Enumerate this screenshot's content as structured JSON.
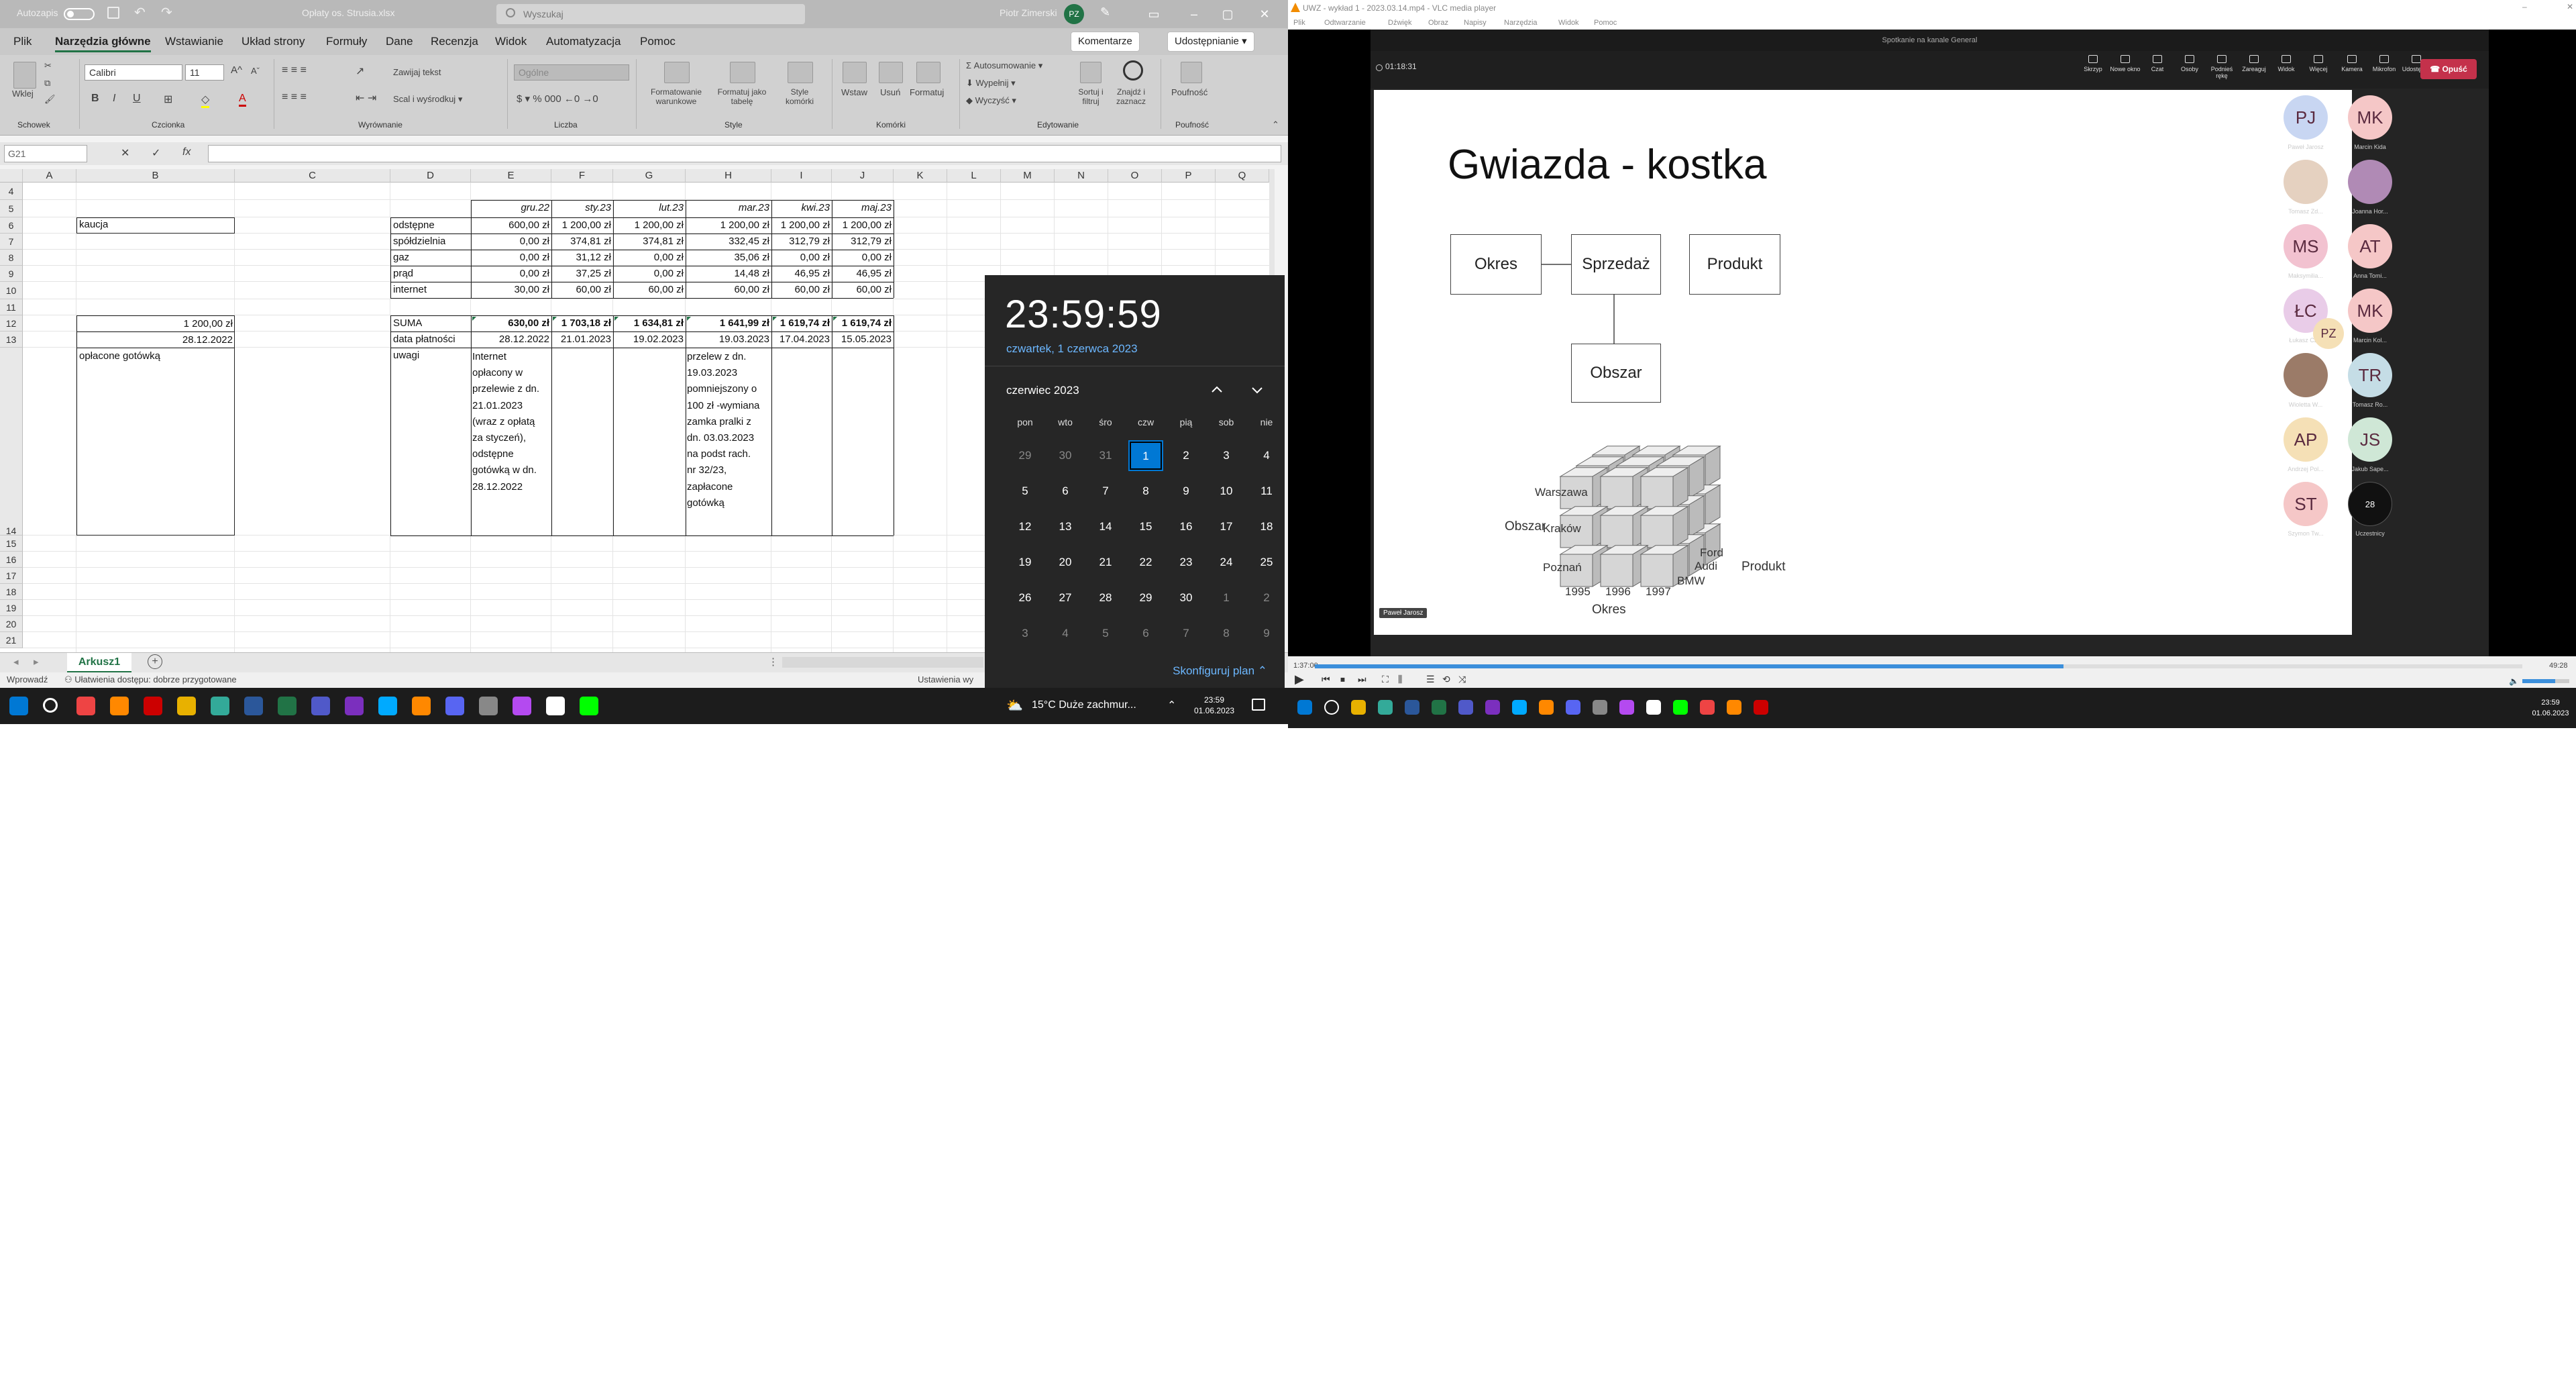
{
  "excel": {
    "autosave_label": "Autozapis",
    "file_name": "Opłaty os. Strusia.xlsx",
    "search_placeholder": "Wyszukaj",
    "user_name": "Piotr Zimerski",
    "user_initials": "PZ",
    "menu": [
      "Plik",
      "Narzędzia główne",
      "Wstawianie",
      "Układ strony",
      "Formuły",
      "Dane",
      "Recenzja",
      "Widok",
      "Automatyzacja",
      "Pomoc"
    ],
    "active_menu": "Narzędzia główne",
    "comments_label": "Komentarze",
    "share_label": "Udostępnianie",
    "ribbon": {
      "paste": "Wklej",
      "font_name": "Calibri",
      "font_size": "11",
      "wrap_text": "Zawijaj tekst",
      "merge": "Scal i wyśrodkuj",
      "number_format": "Ogólne",
      "cond_format": "Formatowanie warunkowe",
      "format_table": "Formatuj jako tabelę",
      "cell_styles": "Style komórki",
      "insert": "Wstaw",
      "delete": "Usuń",
      "format": "Formatuj",
      "autosum": "Autosumowanie",
      "fill": "Wypełnij",
      "clear": "Wyczyść",
      "sort": "Sortuj i filtruj",
      "find": "Znajdź i zaznacz",
      "sensitivity": "Poufność",
      "groups": [
        "Schowek",
        "Czcionka",
        "Wyrównanie",
        "Liczba",
        "Style",
        "Komórki",
        "Edytowanie",
        "Poufność"
      ]
    },
    "name_box": "G21",
    "fx": "fx",
    "columns": [
      "A",
      "B",
      "C",
      "D",
      "E",
      "F",
      "G",
      "H",
      "I",
      "J",
      "K",
      "L",
      "M",
      "N",
      "O",
      "P",
      "Q"
    ],
    "rows": [
      "4",
      "5",
      "6",
      "7",
      "8",
      "9",
      "10",
      "11",
      "12",
      "13",
      "14",
      "15",
      "16",
      "17",
      "18",
      "19",
      "20",
      "21"
    ],
    "cells": {
      "b6": "kaucja",
      "b12": "1 200,00 zł",
      "b13": "28.12.2022",
      "b14": "opłacone gotówką",
      "headers": [
        "gru.22",
        "sty.23",
        "lut.23",
        "mar.23",
        "kwi.23",
        "maj.23"
      ],
      "labels": [
        "odstępne",
        "spółdzielnia",
        "gaz",
        "prąd",
        "internet"
      ],
      "values": [
        [
          "600,00 zł",
          "1 200,00 zł",
          "1 200,00 zł",
          "1 200,00 zł",
          "1 200,00 zł",
          "1 200,00 zł"
        ],
        [
          "0,00 zł",
          "374,81 zł",
          "374,81 zł",
          "332,45 zł",
          "312,79 zł",
          "312,79 zł"
        ],
        [
          "0,00 zł",
          "31,12 zł",
          "0,00 zł",
          "35,06 zł",
          "0,00 zł",
          "0,00 zł"
        ],
        [
          "0,00 zł",
          "37,25 zł",
          "0,00 zł",
          "14,48 zł",
          "46,95 zł",
          "46,95 zł"
        ],
        [
          "30,00 zł",
          "60,00 zł",
          "60,00 zł",
          "60,00 zł",
          "60,00 zł",
          "60,00 zł"
        ]
      ],
      "suma_label": "SUMA",
      "suma": [
        "630,00 zł",
        "1 703,18 zł",
        "1 634,81 zł",
        "1 641,99 zł",
        "1 619,74 zł",
        "1 619,74 zł"
      ],
      "date_label": "data płatności",
      "dates": [
        "28.12.2022",
        "21.01.2023",
        "19.02.2023",
        "19.03.2023",
        "17.04.2023",
        "15.05.2023"
      ],
      "notes_label": "uwagi",
      "note_e": "Internet\nopłacony w\nprzelewie z dn.\n21.01.2023\n(wraz z opłatą\nza styczeń),\nodstępne\ngotówką w dn.\n28.12.2022",
      "note_h": "przelew z dn.\n19.03.2023\npomniejszony o\n100 zł -wymiana\nzamka pralki z\ndn. 03.03.2023\nna podst rach.\nnr 32/23,\nzapłacone\ngotówką"
    },
    "sheet_tab": "Arkusz1",
    "status_ready": "Wprowadź",
    "accessibility": "Ułatwienia dostępu: dobrze przygotowane",
    "display_settings": "Ustawienia wy"
  },
  "calendar": {
    "time": "23:59:59",
    "date_long": "czwartek, 1 czerwca 2023",
    "month": "czerwiec 2023",
    "weekdays": [
      "pon",
      "wto",
      "śro",
      "czw",
      "pią",
      "sob",
      "nie"
    ],
    "days": [
      [
        "29",
        "30",
        "31",
        "1",
        "2",
        "3",
        "4"
      ],
      [
        "5",
        "6",
        "7",
        "8",
        "9",
        "10",
        "11"
      ],
      [
        "12",
        "13",
        "14",
        "15",
        "16",
        "17",
        "18"
      ],
      [
        "19",
        "20",
        "21",
        "22",
        "23",
        "24",
        "25"
      ],
      [
        "26",
        "27",
        "28",
        "29",
        "30",
        "1",
        "2"
      ],
      [
        "3",
        "4",
        "5",
        "6",
        "7",
        "8",
        "9"
      ]
    ],
    "configure": "Skonfiguruj plan"
  },
  "taskbar_left": {
    "weather": "15°C  Duże zachmur...",
    "time": "23:59",
    "date": "01.06.2023"
  },
  "vlc": {
    "title": "UWZ - wykład 1 - 2023.03.14.mp4 - VLC media player",
    "menu": [
      "Plik",
      "Odtwarzanie",
      "Dźwięk",
      "Obraz",
      "Napisy",
      "Narzędzia",
      "Widok",
      "Pomoc"
    ],
    "teams_title": "Spotkanie na kanale General",
    "meeting_timer": "01:18:31",
    "toolbar": [
      "Skrzyp",
      "Nowe okno",
      "Czat",
      "Osoby",
      "Podnieś rękę",
      "Zareaguj",
      "Widok",
      "Więcej",
      "Kamera",
      "Mikrofon",
      "Udostępnij"
    ],
    "leave": "Opuść",
    "slide": {
      "title": "Gwiazda - kostka",
      "boxes": [
        "Okres",
        "Sprzedaż",
        "Produkt",
        "Obszar"
      ],
      "cube_labels": [
        "Warszawa",
        "Kraków",
        "Poznań",
        "1995",
        "1996",
        "1997",
        "BMW",
        "Audi",
        "Ford",
        "Obszar",
        "Produkt",
        "Okres"
      ]
    },
    "presenter": "Paweł Jarosz",
    "participants": [
      {
        "initials": "PJ",
        "name": "Paweł Jarosz",
        "color": "#c8d6f2"
      },
      {
        "initials": "MK",
        "name": "Marcin Kida",
        "color": "#f5c7c7"
      },
      {
        "initials": "",
        "name": "Tomasz Zd...",
        "color": "#e5d1c0"
      },
      {
        "initials": "",
        "name": "Joanna Hor...",
        "color": "#b08ab5"
      },
      {
        "initials": "MS",
        "name": "Maksymilia...",
        "color": "#f2c2d0"
      },
      {
        "initials": "AT",
        "name": "Anna Tomi...",
        "color": "#f5c7c7"
      },
      {
        "initials": "ŁC",
        "name": "Łukasz Cz...",
        "color": "#e9cce8"
      },
      {
        "initials": "MK",
        "name": "Marcin Kol...",
        "color": "#f5c7c7"
      },
      {
        "initials": "",
        "name": "Wioletta W...",
        "color": "#9b7b68"
      },
      {
        "initials": "TR",
        "name": "Tomasz Ro...",
        "color": "#c5dde6"
      },
      {
        "initials": "AP",
        "name": "Andrzej Pol...",
        "color": "#f5e0b6"
      },
      {
        "initials": "JS",
        "name": "Jakub Sape...",
        "color": "#cfe7d6"
      },
      {
        "initials": "ST",
        "name": "Szymon Tw...",
        "color": "#f5c7c7"
      },
      {
        "initials": "28",
        "name": "Uczestnicy",
        "color": "#111111"
      },
      {
        "initials": "PZ",
        "name": "",
        "color": "#f5e0b6"
      }
    ],
    "time_elapsed": "1:37:00",
    "time_total": "49:28",
    "progress": 0.62
  },
  "taskbar_right": {
    "time": "23:59",
    "date": "01.06.2023"
  }
}
